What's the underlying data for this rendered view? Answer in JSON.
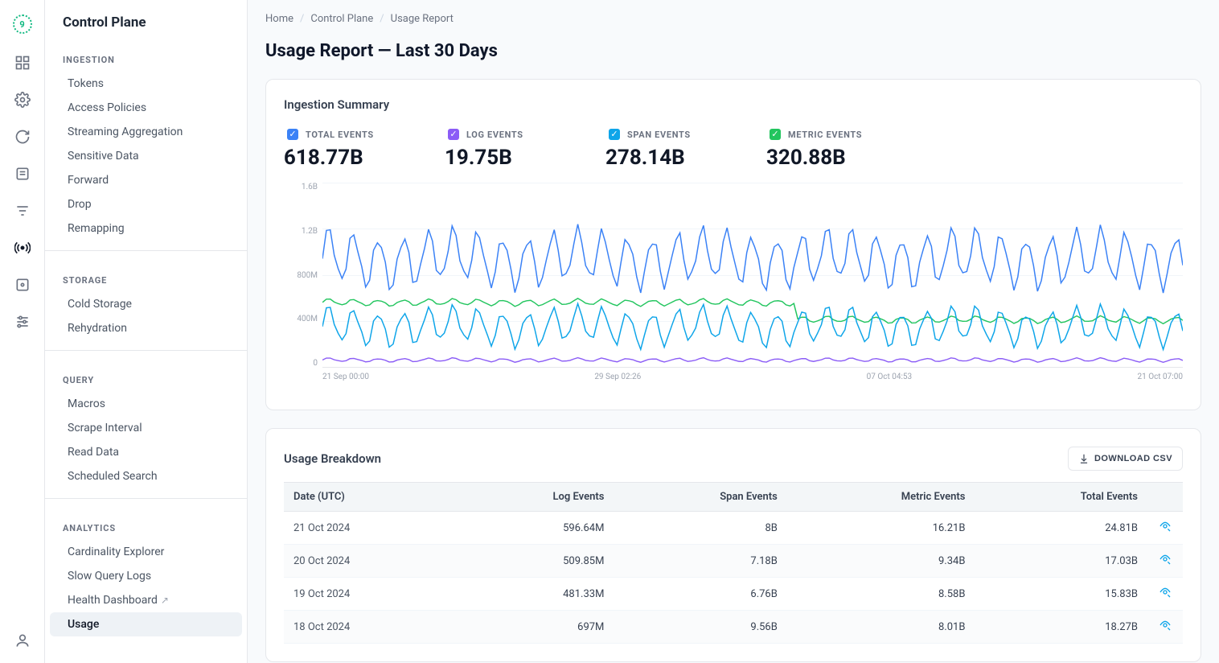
{
  "rail": {
    "logo": "9"
  },
  "sidebar": {
    "title": "Control Plane",
    "groups": [
      {
        "label": "INGESTION",
        "items": [
          "Tokens",
          "Access Policies",
          "Streaming Aggregation",
          "Sensitive Data",
          "Forward",
          "Drop",
          "Remapping"
        ]
      },
      {
        "label": "STORAGE",
        "items": [
          "Cold Storage",
          "Rehydration"
        ]
      },
      {
        "label": "QUERY",
        "items": [
          "Macros",
          "Scrape Interval",
          "Read Data",
          "Scheduled Search"
        ]
      },
      {
        "label": "ANALYTICS",
        "items": [
          "Cardinality Explorer",
          "Slow Query Logs",
          "Health Dashboard ↗",
          "Usage"
        ]
      }
    ],
    "active_item": "Usage"
  },
  "breadcrumbs": [
    "Home",
    "Control Plane",
    "Usage Report"
  ],
  "page_title": "Usage Report — Last 30 Days",
  "summary": {
    "title": "Ingestion Summary",
    "metrics": [
      {
        "label": "TOTAL EVENTS",
        "value": "618.77B",
        "color": "#3b82f6"
      },
      {
        "label": "LOG EVENTS",
        "value": "19.75B",
        "color": "#8b5cf6"
      },
      {
        "label": "SPAN EVENTS",
        "value": "278.14B",
        "color": "#0ea5e9"
      },
      {
        "label": "METRIC EVENTS",
        "value": "320.88B",
        "color": "#22c55e"
      }
    ]
  },
  "chart_data": {
    "type": "line",
    "xlabel": "",
    "ylabel": "",
    "ylim": [
      0,
      1600000000
    ],
    "y_ticks": [
      "1.6B",
      "1.2B",
      "800M",
      "400M",
      "0"
    ],
    "x_ticks": [
      "21 Sep 00:00",
      "29 Sep 02:26",
      "07 Oct 04:53",
      "21 Oct 07:00"
    ],
    "series": [
      {
        "name": "Total Events",
        "color": "#3b82f6",
        "avg_M": 940,
        "amp_M": 300
      },
      {
        "name": "Metric Events",
        "color": "#22c55e",
        "avg_M": 560,
        "amp_M": 35,
        "step_at": 0.55,
        "step_to_avg_M": 410
      },
      {
        "name": "Span Events",
        "color": "#0ea5e9",
        "avg_M": 350,
        "amp_M": 200
      },
      {
        "name": "Log Events",
        "color": "#8b5cf6",
        "avg_M": 60,
        "amp_M": 20
      }
    ]
  },
  "breakdown": {
    "title": "Usage Breakdown",
    "download_label": "DOWNLOAD CSV",
    "columns": [
      "Date (UTC)",
      "Log Events",
      "Span Events",
      "Metric Events",
      "Total Events",
      ""
    ],
    "rows": [
      {
        "date": "21 Oct 2024",
        "log": "596.64M",
        "span": "8B",
        "metric": "16.21B",
        "total": "24.81B"
      },
      {
        "date": "20 Oct 2024",
        "log": "509.85M",
        "span": "7.18B",
        "metric": "9.34B",
        "total": "17.03B"
      },
      {
        "date": "19 Oct 2024",
        "log": "481.33M",
        "span": "6.76B",
        "metric": "8.58B",
        "total": "15.83B"
      },
      {
        "date": "18 Oct 2024",
        "log": "697M",
        "span": "9.56B",
        "metric": "8.01B",
        "total": "18.27B"
      }
    ]
  }
}
